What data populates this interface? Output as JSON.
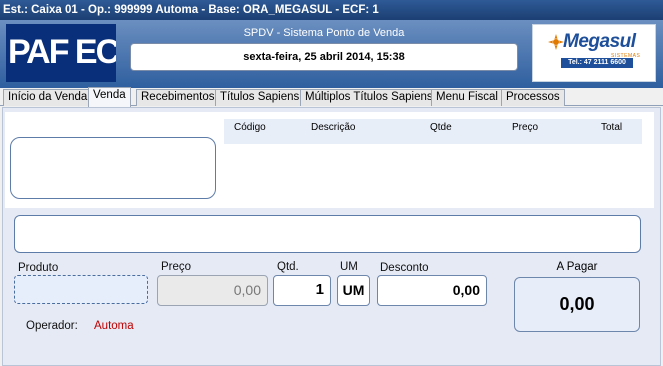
{
  "window": {
    "title": "Est.: Caixa 01 - Op.: 999999 Automa - Base: ORA_MEGASUL - ECF: 1"
  },
  "header": {
    "logo_text": "PAF ECF",
    "system_title": "SPDV - Sistema Ponto de Venda",
    "datetime": "sexta-feira, 25 abril 2014, 15:38",
    "brand": {
      "name": "Megasul",
      "subtitle": "SISTEMAS",
      "phone": "Tel.: 47 2111 6600"
    }
  },
  "tabs": [
    {
      "label": "Início da Venda",
      "active": false
    },
    {
      "label": "Venda",
      "active": true
    },
    {
      "label": "Recebimentos",
      "active": false
    },
    {
      "label": "Títulos Sapiens",
      "active": false
    },
    {
      "label": "Múltiplos Títulos Sapiens",
      "active": false
    },
    {
      "label": "Menu Fiscal",
      "active": false
    },
    {
      "label": "Processos",
      "active": false
    }
  ],
  "grid": {
    "columns": [
      "Código",
      "Descrição",
      "Qtde",
      "Preço",
      "Total"
    ],
    "rows": []
  },
  "fields": {
    "produto": {
      "label": "Produto",
      "value": ""
    },
    "preco": {
      "label": "Preço",
      "value": "0,00"
    },
    "qtd": {
      "label": "Qtd.",
      "value": "1"
    },
    "um": {
      "label": "UM",
      "value": "UM"
    },
    "desconto": {
      "label": "Desconto",
      "value": "0,00"
    },
    "a_pagar": {
      "label": "A Pagar",
      "value": "0,00"
    }
  },
  "operador": {
    "label": "Operador:",
    "value": "Automa"
  },
  "colors": {
    "title_bar": "#1c3f73",
    "header_top": "#6b8fc0",
    "header_bottom": "#2f5f9f",
    "panel_bg": "#e5eaf5",
    "operator_value": "#c00000",
    "brand_blue": "#1d4f9a",
    "brand_orange": "#e07a00"
  }
}
